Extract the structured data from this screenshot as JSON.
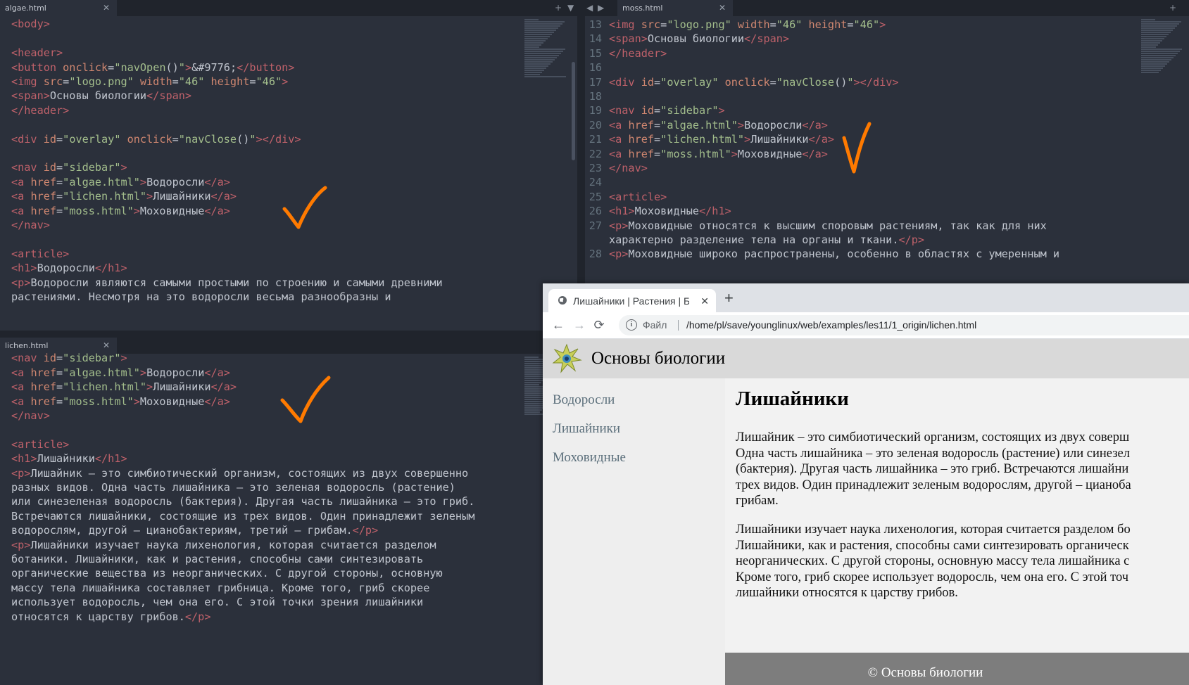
{
  "editor_left_top": {
    "tab": "algae.html",
    "lines": [
      [],
      [
        [
          "tg",
          "<body>"
        ]
      ],
      [],
      [
        [
          "tg",
          "<header>"
        ]
      ],
      [
        [
          "tg",
          "<button "
        ],
        [
          "at",
          "onclick"
        ],
        [
          "tx",
          "="
        ],
        [
          "st",
          "\"navOpen"
        ],
        [
          "tx",
          "()"
        ],
        [
          "st",
          "\""
        ],
        [
          "tg",
          ">"
        ],
        [
          "tx",
          "&#9776;"
        ],
        [
          "tg",
          "</button>"
        ]
      ],
      [
        [
          "tg",
          "<img "
        ],
        [
          "at",
          "src"
        ],
        [
          "tx",
          "="
        ],
        [
          "st",
          "\"logo.png\""
        ],
        [
          "at",
          " width"
        ],
        [
          "tx",
          "="
        ],
        [
          "st",
          "\"46\""
        ],
        [
          "at",
          " height"
        ],
        [
          "tx",
          "="
        ],
        [
          "st",
          "\"46\""
        ],
        [
          "tg",
          ">"
        ]
      ],
      [
        [
          "tg",
          "<span>"
        ],
        [
          "tx",
          "Основы биологии"
        ],
        [
          "tg",
          "</span>"
        ]
      ],
      [
        [
          "tg",
          "</header>"
        ]
      ],
      [],
      [
        [
          "tg",
          "<div "
        ],
        [
          "at",
          "id"
        ],
        [
          "tx",
          "="
        ],
        [
          "st",
          "\"overlay\""
        ],
        [
          "at",
          " onclick"
        ],
        [
          "tx",
          "="
        ],
        [
          "st",
          "\"navClose"
        ],
        [
          "tx",
          "()"
        ],
        [
          "st",
          "\""
        ],
        [
          "tg",
          "></div>"
        ]
      ],
      [],
      [
        [
          "tg",
          "<nav "
        ],
        [
          "at",
          "id"
        ],
        [
          "tx",
          "="
        ],
        [
          "st",
          "\"sidebar\""
        ],
        [
          "tg",
          ">"
        ]
      ],
      [
        [
          "tg",
          "<a "
        ],
        [
          "at",
          "href"
        ],
        [
          "tx",
          "="
        ],
        [
          "st",
          "\"algae.html\""
        ],
        [
          "tg",
          ">"
        ],
        [
          "tx",
          "Водоросли"
        ],
        [
          "tg",
          "</a>"
        ]
      ],
      [
        [
          "tg",
          "<a "
        ],
        [
          "at",
          "href"
        ],
        [
          "tx",
          "="
        ],
        [
          "st",
          "\"lichen.html\""
        ],
        [
          "tg",
          ">"
        ],
        [
          "tx",
          "Лишайники"
        ],
        [
          "tg",
          "</a>"
        ]
      ],
      [
        [
          "tg",
          "<a "
        ],
        [
          "at",
          "href"
        ],
        [
          "tx",
          "="
        ],
        [
          "st",
          "\"moss.html\""
        ],
        [
          "tg",
          ">"
        ],
        [
          "tx",
          "Моховидные"
        ],
        [
          "tg",
          "</a>"
        ]
      ],
      [
        [
          "tg",
          "</nav>"
        ]
      ],
      [],
      [
        [
          "tg",
          "<article>"
        ]
      ],
      [
        [
          "tg",
          "<h1>"
        ],
        [
          "tx",
          "Водоросли"
        ],
        [
          "tg",
          "</h1>"
        ]
      ],
      [
        [
          "tg",
          "<p>"
        ],
        [
          "tx",
          "Водоросли являются самыми простыми по строению и самыми древними"
        ]
      ],
      [
        [
          "tx",
          "растениями. Несмотря на это водоросли весьма разнообразны и"
        ]
      ]
    ]
  },
  "editor_left_bottom": {
    "tab": "lichen.html",
    "lines": [
      [],
      [
        [
          "tg",
          "<nav "
        ],
        [
          "at",
          "id"
        ],
        [
          "tx",
          "="
        ],
        [
          "st",
          "\"sidebar\""
        ],
        [
          "tg",
          ">"
        ]
      ],
      [
        [
          "tg",
          "<a "
        ],
        [
          "at",
          "href"
        ],
        [
          "tx",
          "="
        ],
        [
          "st",
          "\"algae.html\""
        ],
        [
          "tg",
          ">"
        ],
        [
          "tx",
          "Водоросли"
        ],
        [
          "tg",
          "</a>"
        ]
      ],
      [
        [
          "tg",
          "<a "
        ],
        [
          "at",
          "href"
        ],
        [
          "tx",
          "="
        ],
        [
          "st",
          "\"lichen.html\""
        ],
        [
          "tg",
          ">"
        ],
        [
          "tx",
          "Лишайники"
        ],
        [
          "tg",
          "</a>"
        ]
      ],
      [
        [
          "tg",
          "<a "
        ],
        [
          "at",
          "href"
        ],
        [
          "tx",
          "="
        ],
        [
          "st",
          "\"moss.html\""
        ],
        [
          "tg",
          ">"
        ],
        [
          "tx",
          "Моховидные"
        ],
        [
          "tg",
          "</a>"
        ]
      ],
      [
        [
          "tg",
          "</nav>"
        ]
      ],
      [],
      [
        [
          "tg",
          "<article>"
        ]
      ],
      [
        [
          "tg",
          "<h1>"
        ],
        [
          "tx",
          "Лишайники"
        ],
        [
          "tg",
          "</h1>"
        ]
      ],
      [
        [
          "tg",
          "<p>"
        ],
        [
          "tx",
          "Лишайник – это симбиотический организм, состоящих из двух совершенно"
        ]
      ],
      [
        [
          "tx",
          "разных видов. Одна часть лишайника – это зеленая водоросль (растение)"
        ]
      ],
      [
        [
          "tx",
          "или синезеленая водоросль (бактерия). Другая часть лишайника – это гриб."
        ]
      ],
      [
        [
          "tx",
          "Встречаются лишайники, состоящие из трех видов. Один принадлежит зеленым"
        ]
      ],
      [
        [
          "tx",
          "водорослям, другой – цианобактериям, третий – грибам."
        ],
        [
          "tg",
          "</p>"
        ]
      ],
      [
        [
          "tg",
          "<p>"
        ],
        [
          "tx",
          "Лишайники изучает наука лихенология, которая считается разделом"
        ]
      ],
      [
        [
          "tx",
          "ботаники. Лишайники, как и растения, способны сами синтезировать"
        ]
      ],
      [
        [
          "tx",
          "органические вещества из неорганических. С другой стороны, основную"
        ]
      ],
      [
        [
          "tx",
          "массу тела лишайника составляет грибница. Кроме того, гриб скорее"
        ]
      ],
      [
        [
          "tx",
          "использует водоросль, чем она его. С этой точки зрения лишайники"
        ]
      ],
      [
        [
          "tx",
          "относятся к царству грибов."
        ],
        [
          "tg",
          "</p>"
        ]
      ]
    ]
  },
  "editor_right": {
    "tab": "moss.html",
    "rows": [
      {
        "n": "13",
        "segs": [
          [
            "tg",
            "<img "
          ],
          [
            "at",
            "src"
          ],
          [
            "tx",
            "="
          ],
          [
            "st",
            "\"logo.png\""
          ],
          [
            "at",
            " width"
          ],
          [
            "tx",
            "="
          ],
          [
            "st",
            "\"46\""
          ],
          [
            "at",
            " height"
          ],
          [
            "tx",
            "="
          ],
          [
            "st",
            "\"46\""
          ],
          [
            "tg",
            ">"
          ]
        ]
      },
      {
        "n": "14",
        "segs": [
          [
            "tg",
            "<span>"
          ],
          [
            "tx",
            "Основы биологии"
          ],
          [
            "tg",
            "</span>"
          ]
        ]
      },
      {
        "n": "15",
        "segs": [
          [
            "tg",
            "</header>"
          ]
        ]
      },
      {
        "n": "16",
        "segs": []
      },
      {
        "n": "17",
        "segs": [
          [
            "tg",
            "<div "
          ],
          [
            "at",
            "id"
          ],
          [
            "tx",
            "="
          ],
          [
            "st",
            "\"overlay\""
          ],
          [
            "at",
            " onclick"
          ],
          [
            "tx",
            "="
          ],
          [
            "st",
            "\"navClose"
          ],
          [
            "tx",
            "()"
          ],
          [
            "st",
            "\""
          ],
          [
            "tg",
            "></div>"
          ]
        ]
      },
      {
        "n": "18",
        "segs": []
      },
      {
        "n": "19",
        "segs": [
          [
            "tg",
            "<nav "
          ],
          [
            "at",
            "id"
          ],
          [
            "tx",
            "="
          ],
          [
            "st",
            "\"sidebar\""
          ],
          [
            "tg",
            ">"
          ]
        ]
      },
      {
        "n": "20",
        "segs": [
          [
            "tg",
            "<a "
          ],
          [
            "at",
            "href"
          ],
          [
            "tx",
            "="
          ],
          [
            "st",
            "\"algae.html\""
          ],
          [
            "tg",
            ">"
          ],
          [
            "tx",
            "Водоросли"
          ],
          [
            "tg",
            "</a>"
          ]
        ]
      },
      {
        "n": "21",
        "segs": [
          [
            "tg",
            "<a "
          ],
          [
            "at",
            "href"
          ],
          [
            "tx",
            "="
          ],
          [
            "st",
            "\"lichen.html\""
          ],
          [
            "tg",
            ">"
          ],
          [
            "tx",
            "Лишайники"
          ],
          [
            "tg",
            "</a>"
          ]
        ]
      },
      {
        "n": "22",
        "segs": [
          [
            "tg",
            "<a "
          ],
          [
            "at",
            "href"
          ],
          [
            "tx",
            "="
          ],
          [
            "st",
            "\"moss.html\""
          ],
          [
            "tg",
            ">"
          ],
          [
            "tx",
            "Моховидные"
          ],
          [
            "tg",
            "</a>"
          ]
        ]
      },
      {
        "n": "23",
        "segs": [
          [
            "tg",
            "</nav>"
          ]
        ]
      },
      {
        "n": "24",
        "segs": []
      },
      {
        "n": "25",
        "segs": [
          [
            "tg",
            "<article>"
          ]
        ]
      },
      {
        "n": "26",
        "segs": [
          [
            "tg",
            "<h1>"
          ],
          [
            "tx",
            "Моховидные"
          ],
          [
            "tg",
            "</h1>"
          ]
        ]
      },
      {
        "n": "27",
        "segs": [
          [
            "tg",
            "<p>"
          ],
          [
            "tx",
            "Моховидные относятся к высшим споровым растениям, так как для них"
          ]
        ]
      },
      {
        "n": "",
        "segs": [
          [
            "tx",
            "характерно разделение тела на органы и ткани."
          ],
          [
            "tg",
            "</p>"
          ]
        ]
      },
      {
        "n": "28",
        "segs": [
          [
            "tg",
            "<p>"
          ],
          [
            "tx",
            "Моховидные широко распространены, особенно в областях с умеренным и"
          ]
        ]
      }
    ]
  },
  "browser": {
    "tab_title": "Лишайники | Растения | Био",
    "scheme_label": "Файл",
    "url": "/home/pl/save/younglinux/web/examples/les11/1_origin/lichen.html",
    "site_title": "Основы биологии",
    "sidebar_links": [
      "Водоросли",
      "Лишайники",
      "Моховидные"
    ],
    "article_title": "Лишайники",
    "paragraph_1": "Лишайник – это симбиотический организм, состоящих из двух соверш\nОдна часть лишайника – это зеленая водоросль (растение) или синезел\n(бактерия). Другая часть лишайника – это гриб. Встречаются лишайни\nтрех видов. Один принадлежит зеленым водорослям, другой – цианоба\nгрибам.",
    "paragraph_2": "Лишайники изучает наука лихенология, которая считается разделом бо\nЛишайники, как и растения, способны сами синтезировать органическ\nнеорганических. С другой стороны, основную массу тела лишайника с\nКроме того, гриб скорее использует водоросль, чем она его. С этой точ\nлишайники относятся к царству грибов.",
    "footer": "© Основы биологии"
  },
  "colors": {
    "editor_bg": "#2b303b",
    "tag": "#bf616a",
    "attr": "#d08770",
    "string": "#a3be8c",
    "text": "#c0c5ce",
    "check_mark": "#ff7a00"
  },
  "icons": [
    "close-icon",
    "plus-icon",
    "chevron-down-icon",
    "arrow-left-icon",
    "arrow-right-icon",
    "check-mark-icon",
    "globe-icon",
    "reload-icon",
    "info-icon",
    "logo-icon"
  ]
}
